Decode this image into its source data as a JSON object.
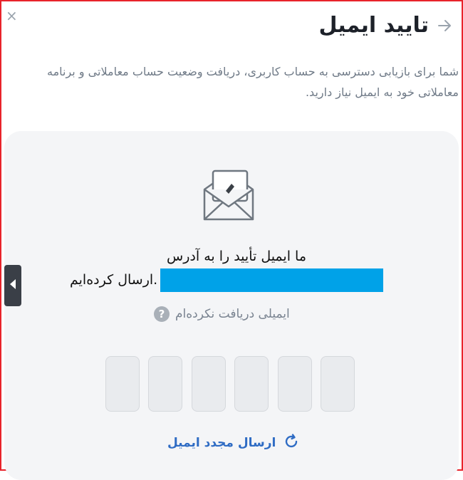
{
  "dialog": {
    "close_symbol": "×",
    "title": "تایید ایمیل",
    "description": "شما برای بازیابی دسترسی به حساب کاربری، دریافت وضعیت حساب معاملاتی و برنامه معاملاتی خود به ایمیل نیاز دارید.",
    "sent_prefix": "ما ایمیل تأیید را به آدرس",
    "sent_suffix": "ارسال کرده‌ایم.",
    "no_email_label": "ایمیلی دریافت نکرده‌ام",
    "help_symbol": "?",
    "resend_label": "ارسال مجدد ایمیل",
    "otp_boxes": 6
  },
  "icons": {
    "close": "close-icon",
    "back": "arrow-right-icon",
    "envelope": "envelope-pencil-icon",
    "help": "question-circle-icon",
    "resend": "refresh-icon",
    "side_tab": "chevron-left-icon"
  },
  "colors": {
    "frame_border": "#e8232a",
    "title": "#1d2129",
    "body_text": "#6f7a87",
    "card_bg": "#f4f5f7",
    "email_mask": "#00a2e8",
    "link": "#2f6cc4"
  }
}
